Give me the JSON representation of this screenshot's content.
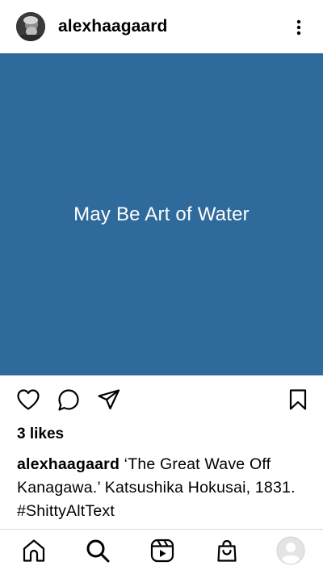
{
  "post": {
    "username": "alexhaagaard",
    "image_alt_text": "May Be Art of Water",
    "image_color": "#2e6a9b",
    "likes": "3 likes",
    "caption_username": "alexhaagaard",
    "caption_text": " ‘The Great Wave Off Kanagawa.’ Katsushika Hokusai, 1831. #ShittyAltText"
  },
  "icons": {
    "header": [
      "avatar",
      "more-vertical-icon"
    ],
    "actions": [
      "heart-icon",
      "comment-icon",
      "share-icon",
      "bookmark-icon"
    ],
    "bottom_nav": [
      "home-icon",
      "search-icon",
      "reels-icon",
      "shop-icon",
      "profile-icon"
    ]
  }
}
